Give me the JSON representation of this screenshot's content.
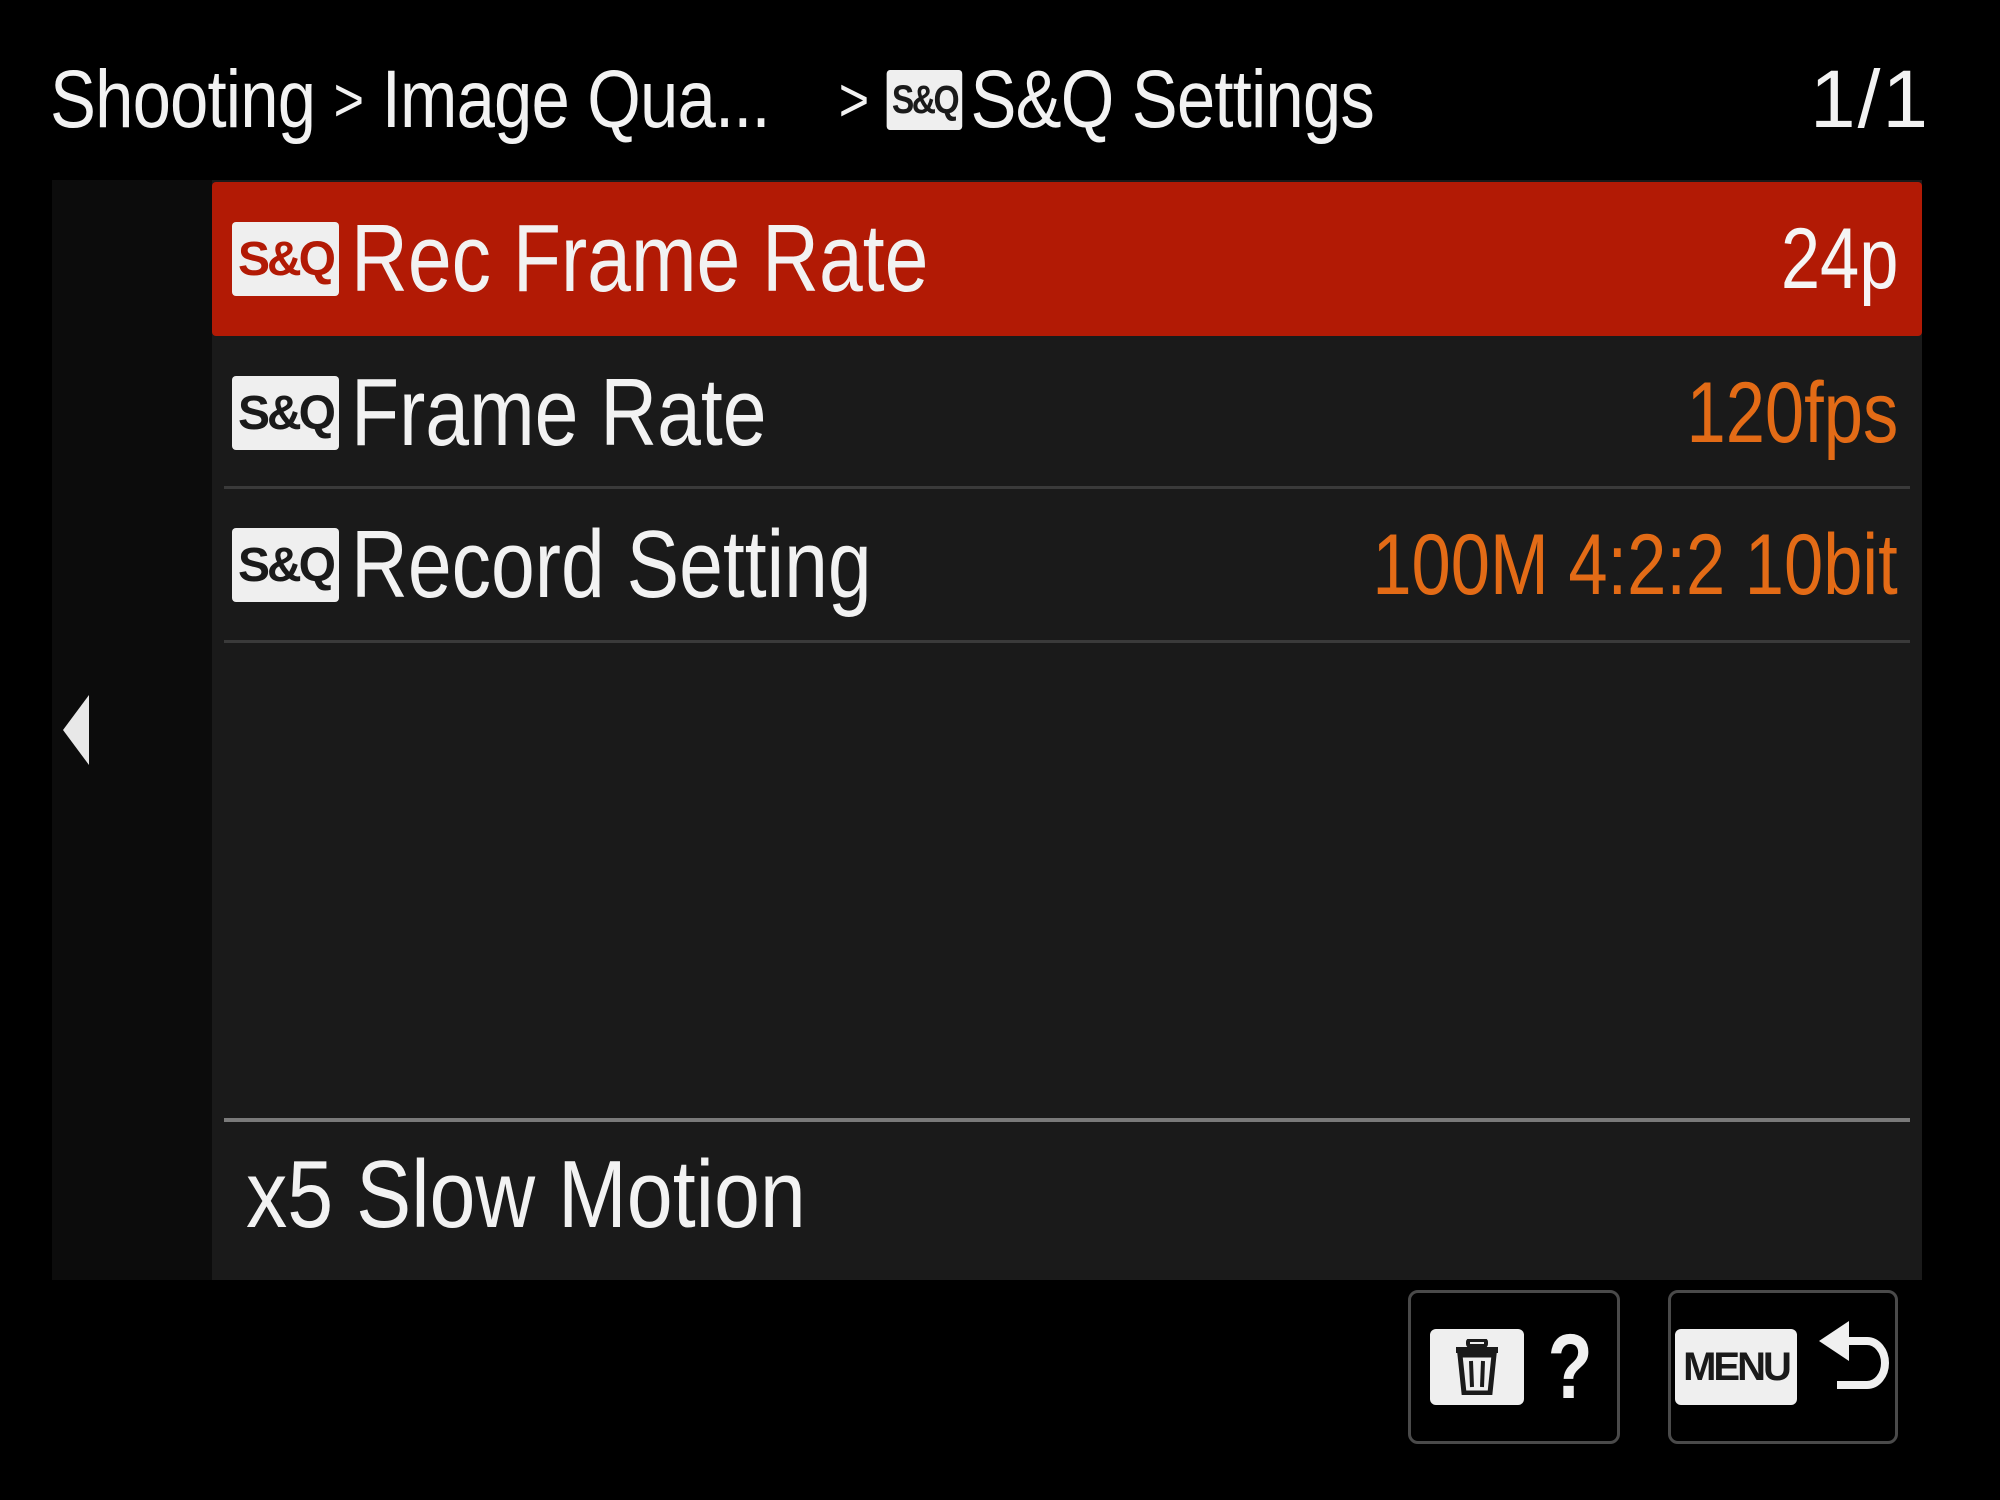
{
  "header": {
    "breadcrumb": [
      {
        "label": "Shooting"
      },
      {
        "label": "Image Qua..."
      }
    ],
    "separator": ">",
    "title_badge": "S&Q",
    "title": "S&Q Settings",
    "page_indicator": "1/1"
  },
  "menu": {
    "items": [
      {
        "badge": "S&Q",
        "label": "Rec Frame Rate",
        "value": "24p",
        "selected": true
      },
      {
        "badge": "S&Q",
        "label": "Frame Rate",
        "value": "120fps",
        "selected": false
      },
      {
        "badge": "S&Q",
        "label": "Record Setting",
        "value": "100M 4:2:2 10bit",
        "selected": false
      }
    ],
    "description": "x5 Slow Motion"
  },
  "footer": {
    "help_glyph": "?",
    "menu_label": "MENU"
  },
  "colors": {
    "background": "#000000",
    "panel": "#1a1a1a",
    "selected_row": "#b21a05",
    "value_text": "#e36b16",
    "text": "#f2f2f2"
  },
  "icons": {
    "left_nav": "triangle-left-icon",
    "delete": "trash-icon",
    "help": "question-icon",
    "back": "return-arrow-icon"
  }
}
